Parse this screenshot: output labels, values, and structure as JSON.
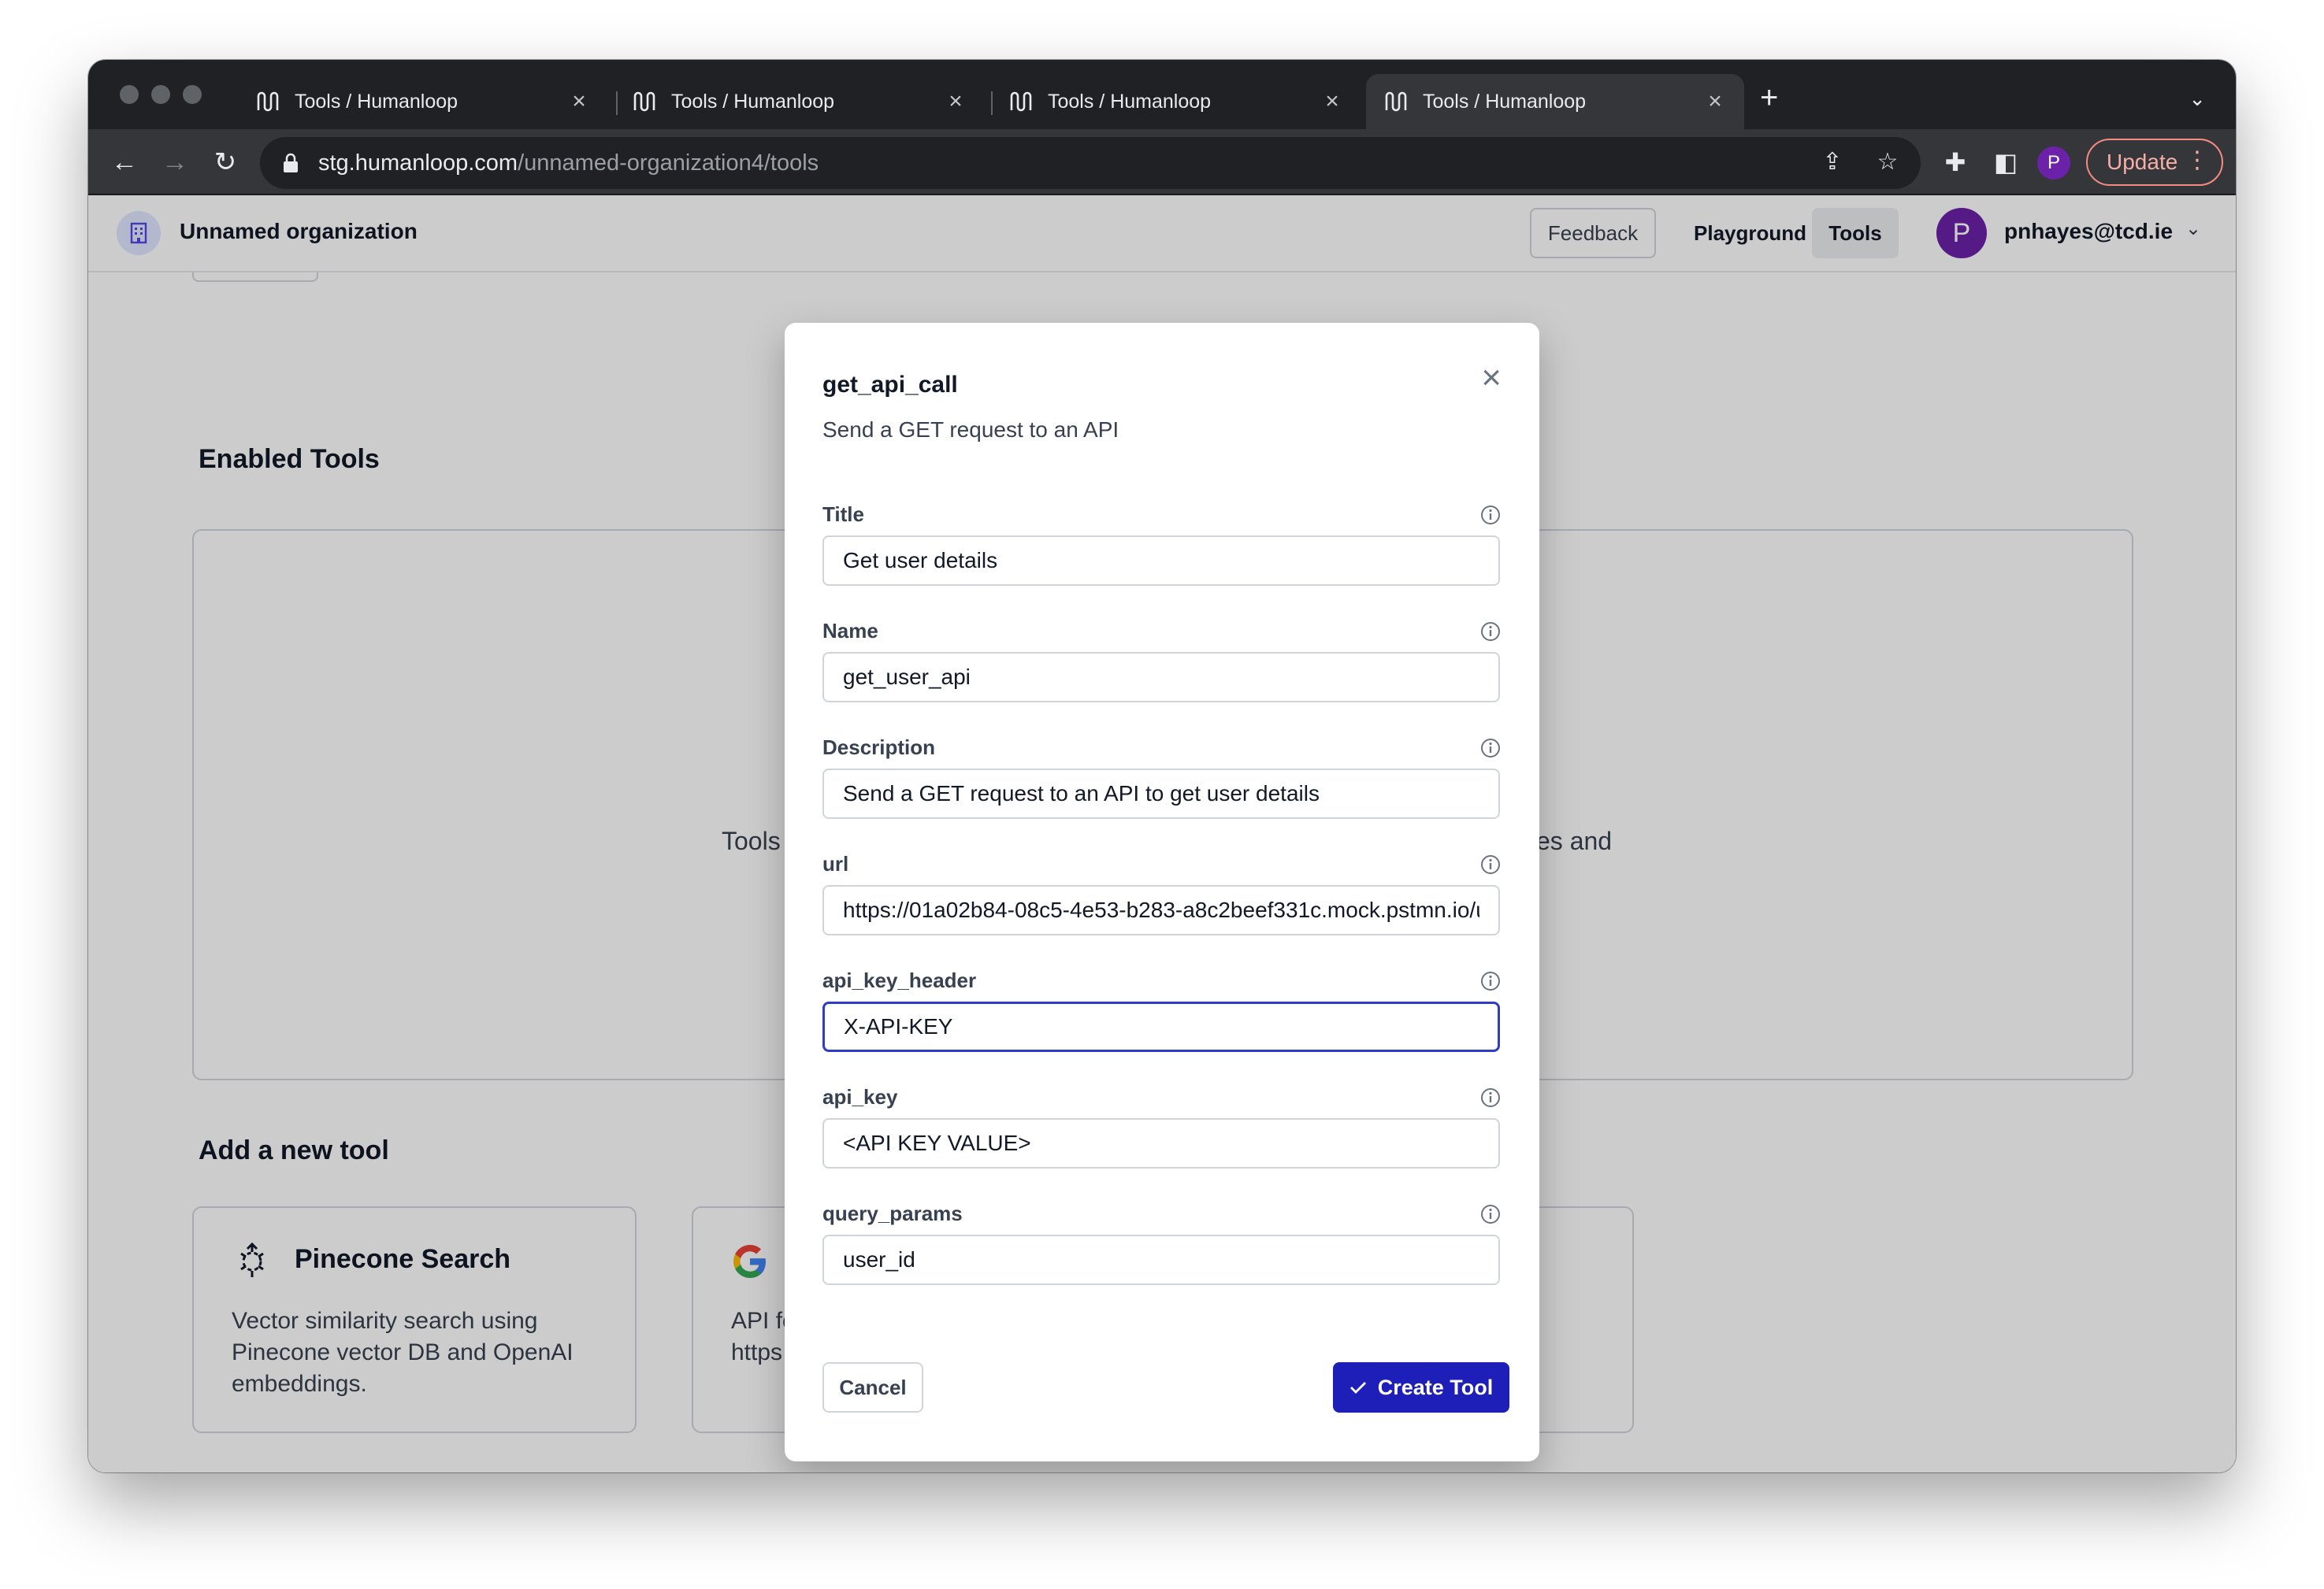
{
  "browser": {
    "tabs": [
      {
        "title": "Tools / Humanloop",
        "active": false
      },
      {
        "title": "Tools / Humanloop",
        "active": false
      },
      {
        "title": "Tools / Humanloop",
        "active": false
      },
      {
        "title": "Tools / Humanloop",
        "active": true
      }
    ],
    "url_host": "stg.humanloop.com",
    "url_path": "/unnamed-organization4/tools",
    "profile_initial": "P",
    "update_label": "Update"
  },
  "appbar": {
    "org_name": "Unnamed organization",
    "nav": {
      "feedback": "Feedback",
      "playground": "Playground",
      "tools": "Tools"
    },
    "user_initial": "P",
    "user_email": "pnhayes@tcd.ie"
  },
  "page": {
    "enabled_title": "Enabled Tools",
    "empty_left": "Tools",
    "empty_right": "es and",
    "add_title": "Add a new tool",
    "cards": [
      {
        "title": "Pinecone Search",
        "desc_lines": [
          "Vector similarity search using",
          "Pinecone vector DB and OpenAI",
          "embeddings."
        ]
      },
      {
        "title": "",
        "desc_lines": [
          "API fo",
          "https"
        ]
      }
    ]
  },
  "modal": {
    "title": "get_api_call",
    "subtitle": "Send a GET request to an API",
    "fields": [
      {
        "label": "Title",
        "value": "Get user details"
      },
      {
        "label": "Name",
        "value": "get_user_api"
      },
      {
        "label": "Description",
        "value": "Send a GET request to an API to get user details"
      },
      {
        "label": "url",
        "value": "https://01a02b84-08c5-4e53-b283-a8c2beef331c.mock.pstmn.io/u"
      },
      {
        "label": "api_key_header",
        "value": "X-API-KEY"
      },
      {
        "label": "api_key",
        "value": "<API KEY VALUE>"
      },
      {
        "label": "query_params",
        "value": "user_id"
      }
    ],
    "cancel_label": "Cancel",
    "create_label": "Create Tool"
  },
  "colors": {
    "accent": "#1e1eb8",
    "avatar": "#6b21a8",
    "focus_border": "#2f3cc8"
  }
}
